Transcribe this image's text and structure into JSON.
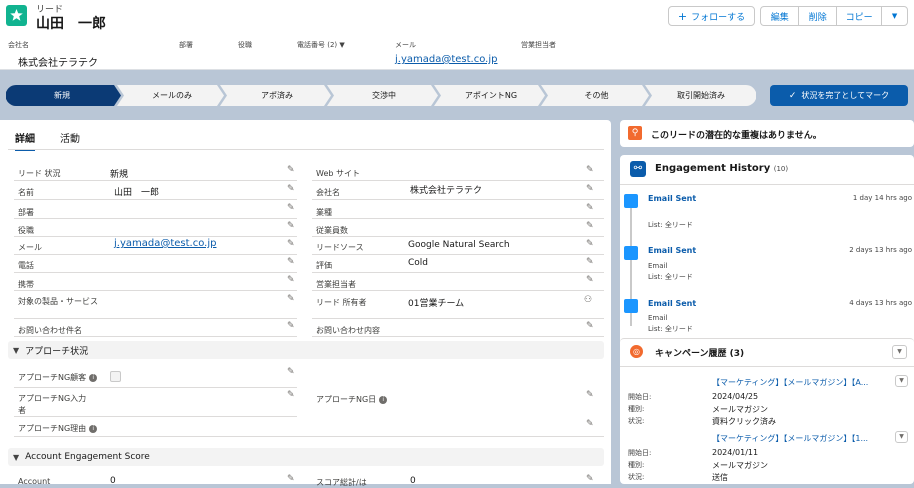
{
  "record": {
    "type": "リード",
    "name": "山田　一郎"
  },
  "actions": {
    "follow": "フォローする",
    "edit": "編集",
    "delete": "削除",
    "copy": "コピー"
  },
  "header_fields": [
    {
      "label": "会社名",
      "value": "株式会社テラテク"
    },
    {
      "label": "部署",
      "value": ""
    },
    {
      "label": "役職",
      "value": ""
    },
    {
      "label": "電話番号 (2) ▼",
      "value": ""
    },
    {
      "label": "メール",
      "value": "j.yamada@test.co.jp"
    },
    {
      "label": "営業担当者",
      "value": ""
    }
  ],
  "path": {
    "stages": [
      "新規",
      "メールのみ",
      "アポ済み",
      "交渉中",
      "アポイントNG",
      "その他",
      "取引開始済み"
    ],
    "current_index": 0,
    "mark_button": "状況を完了としてマーク"
  },
  "tabs": [
    "詳細",
    "活動"
  ],
  "details": {
    "left": [
      {
        "label": "リード 状況",
        "value": "新規"
      },
      {
        "label": "名前",
        "value": "山田　一郎"
      },
      {
        "label": "部署",
        "value": ""
      },
      {
        "label": "役職",
        "value": ""
      },
      {
        "label": "メール",
        "value": "j.yamada@test.co.jp"
      },
      {
        "label": "電話",
        "value": ""
      },
      {
        "label": "携帯",
        "value": ""
      },
      {
        "label": "対象の製品・サービス",
        "value": ""
      },
      {
        "label": "お問い合わせ件名",
        "value": ""
      }
    ],
    "right": [
      {
        "label": "Web サイト",
        "value": ""
      },
      {
        "label": "会社名",
        "value": "株式会社テラテク"
      },
      {
        "label": "業種",
        "value": ""
      },
      {
        "label": "従業員数",
        "value": ""
      },
      {
        "label": "リードソース",
        "value": "Google Natural Search"
      },
      {
        "label": "評価",
        "value": "Cold"
      },
      {
        "label": "営業担当者",
        "value": ""
      },
      {
        "label": "リード 所有者",
        "value": "01営業チーム"
      },
      {
        "label": "お問い合わせ内容",
        "value": ""
      }
    ]
  },
  "approach": {
    "title": "アプローチ状況",
    "ng_customer": "アプローチNG顧客",
    "ng_entrant": "アプローチNG入力者",
    "ng_date": "アプローチNG日",
    "ng_reason": "アプローチNG理由"
  },
  "engagement_score": {
    "title": "Account Engagement Score",
    "label1": "Account",
    "value1": "0",
    "label2": "スコア総計/は",
    "value2": "0"
  },
  "duplicates": "このリードの潜在的な重複はありません。",
  "engagement_history": {
    "title": "Engagement History",
    "count": "(10)",
    "items": [
      {
        "title": "Email Sent",
        "time": "1 day 14 hrs ago",
        "line1": "",
        "line2": "List: 全リード"
      },
      {
        "title": "Email Sent",
        "time": "2 days 13 hrs ago",
        "line1": "Email",
        "line2": "List: 全リード"
      },
      {
        "title": "Email Sent",
        "time": "4 days 13 hrs ago",
        "line1": "Email",
        "line2": "List: 全リード"
      }
    ]
  },
  "campaign_history": {
    "title": "キャンペーン履歴 (3)",
    "items": [
      {
        "name": "【マーケティング】【メールマガジン】【A...",
        "start_label": "開始日:",
        "start": "2024/04/25",
        "type_label": "種別:",
        "type": "メールマガジン",
        "status_label": "状況:",
        "status": "資料クリック済み"
      },
      {
        "name": "【マーケティング】【メールマガジン】【1...",
        "start_label": "開始日:",
        "start": "2024/01/11",
        "type_label": "種別:",
        "type": "メールマガジン",
        "status_label": "状況:",
        "status": "送信"
      }
    ]
  }
}
